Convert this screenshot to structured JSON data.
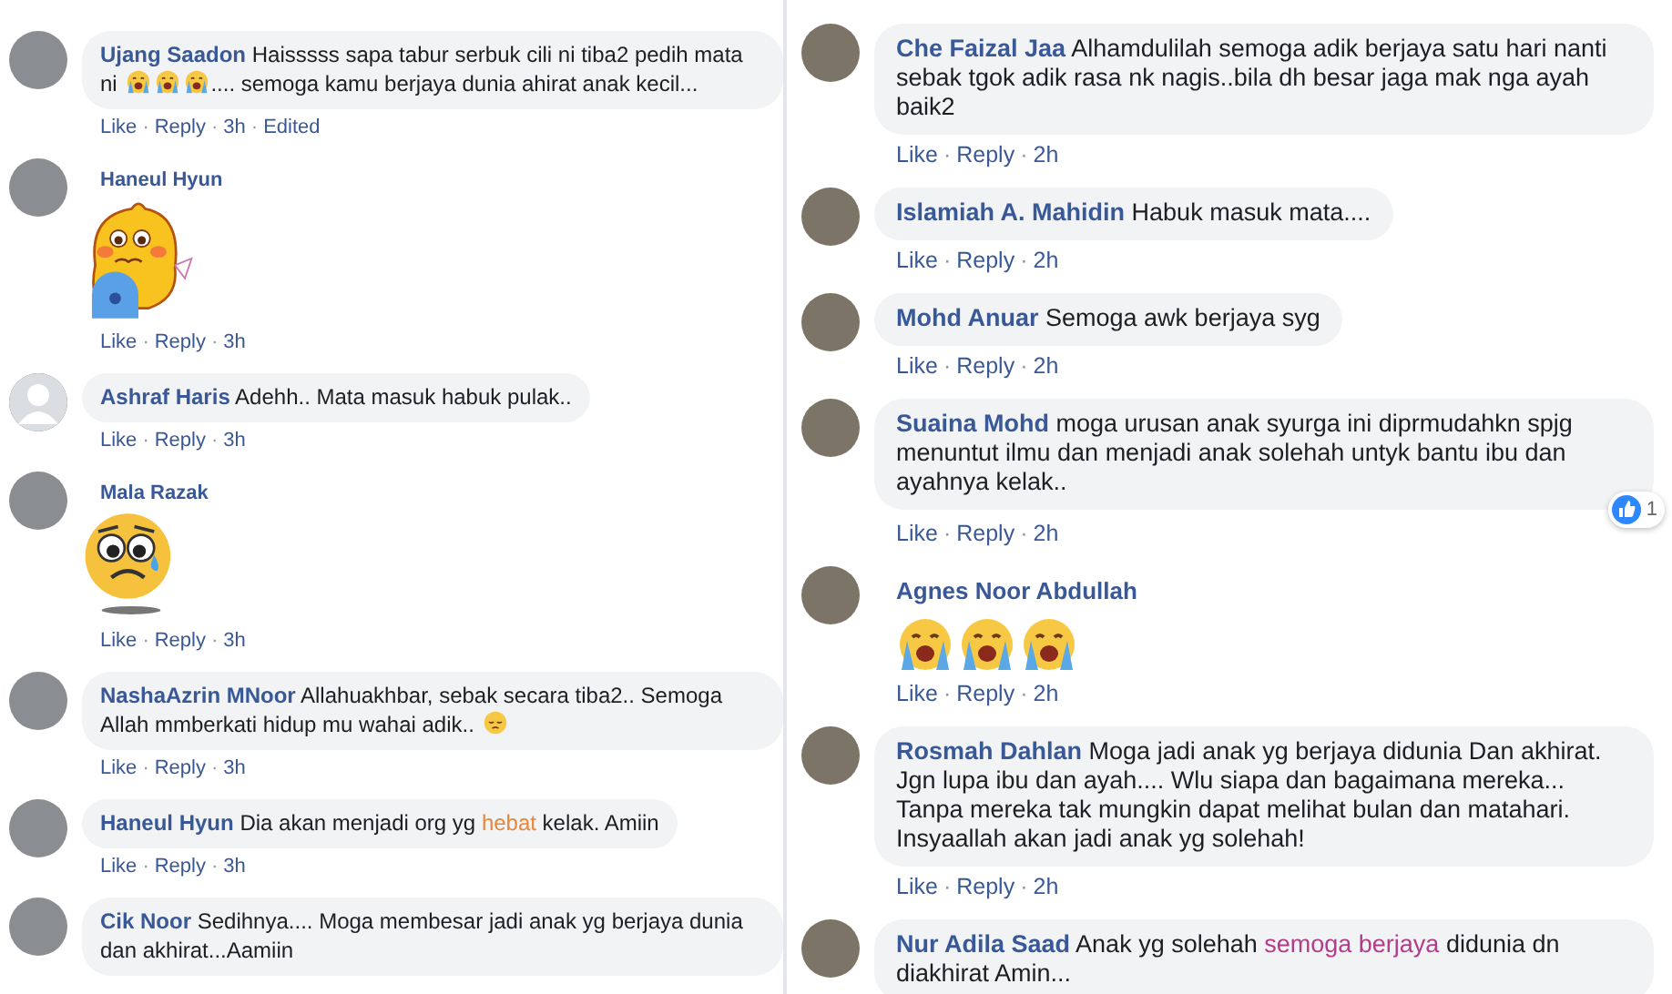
{
  "columns": [
    {
      "comments": [
        {
          "author": "Ujang Saadon",
          "avatar": {
            "kind": "photo"
          },
          "kind": "text",
          "segments": [
            {
              "kind": "text",
              "parts": [
                {
                  "text": "Haisssss sapa tabur serbuk cili ni tiba2 pedih mata ni "
                }
              ]
            },
            {
              "kind": "crying-emoji"
            },
            {
              "kind": "crying-emoji"
            },
            {
              "kind": "crying-emoji"
            },
            {
              "kind": "text",
              "parts": [
                {
                  "text": ".... semoga kamu berjaya dunia ahirat anak kecil..."
                }
              ]
            }
          ],
          "actions": [
            {
              "kind": "link",
              "text": "Like"
            },
            {
              "kind": "separator",
              "text": "·"
            },
            {
              "kind": "link",
              "text": "Reply"
            },
            {
              "kind": "separator",
              "text": "·"
            },
            {
              "kind": "time",
              "text": "3h"
            },
            {
              "kind": "separator",
              "text": "·"
            },
            {
              "kind": "label",
              "text": "Edited"
            }
          ]
        },
        {
          "author": "Haneul Hyun",
          "avatar": {
            "kind": "photo"
          },
          "kind": "sticker-cartoon",
          "actions": [
            {
              "kind": "link",
              "text": "Like"
            },
            {
              "kind": "separator",
              "text": "·"
            },
            {
              "kind": "link",
              "text": "Reply"
            },
            {
              "kind": "separator",
              "text": "·"
            },
            {
              "kind": "time",
              "text": "3h"
            }
          ]
        },
        {
          "author": "Ashraf Haris",
          "avatar": {
            "kind": "default"
          },
          "kind": "text",
          "segments": [
            {
              "kind": "text",
              "parts": [
                {
                  "text": "Adehh.. Mata masuk habuk pulak.."
                }
              ]
            }
          ],
          "actions": [
            {
              "kind": "link",
              "text": "Like"
            },
            {
              "kind": "separator",
              "text": "·"
            },
            {
              "kind": "link",
              "text": "Reply"
            },
            {
              "kind": "separator",
              "text": "·"
            },
            {
              "kind": "time",
              "text": "3h"
            }
          ]
        },
        {
          "author": "Mala Razak",
          "avatar": {
            "kind": "photo"
          },
          "kind": "sticker-sad-face",
          "actions": [
            {
              "kind": "link",
              "text": "Like"
            },
            {
              "kind": "separator",
              "text": "·"
            },
            {
              "kind": "link",
              "text": "Reply"
            },
            {
              "kind": "separator",
              "text": "·"
            },
            {
              "kind": "time",
              "text": "3h"
            }
          ]
        },
        {
          "author": "NashaAzrin MNoor",
          "avatar": {
            "kind": "photo"
          },
          "kind": "text",
          "segments": [
            {
              "kind": "text",
              "parts": [
                {
                  "text": "Allahuakhbar, sebak secara tiba2.. Semoga Allah mmberkati hidup mu wahai adik.. "
                }
              ]
            },
            {
              "kind": "pensive-emoji"
            }
          ],
          "actions": [
            {
              "kind": "link",
              "text": "Like"
            },
            {
              "kind": "separator",
              "text": "·"
            },
            {
              "kind": "link",
              "text": "Reply"
            },
            {
              "kind": "separator",
              "text": "·"
            },
            {
              "kind": "time",
              "text": "3h"
            }
          ]
        },
        {
          "author": "Haneul Hyun",
          "avatar": {
            "kind": "photo"
          },
          "kind": "text",
          "segments": [
            {
              "kind": "text",
              "parts": [
                {
                  "text": "Dia akan menjadi org yg "
                },
                {
                  "text": "hebat",
                  "color": "#e8863a"
                },
                {
                  "text": " kelak. Amiin"
                }
              ]
            }
          ],
          "actions": [
            {
              "kind": "link",
              "text": "Like"
            },
            {
              "kind": "separator",
              "text": "·"
            },
            {
              "kind": "link",
              "text": "Reply"
            },
            {
              "kind": "separator",
              "text": "·"
            },
            {
              "kind": "time",
              "text": "3h"
            }
          ]
        },
        {
          "author": "Cik Noor",
          "avatar": {
            "kind": "photo"
          },
          "kind": "text",
          "segments": [
            {
              "kind": "text",
              "parts": [
                {
                  "text": "Sedihnya.... Moga membesar jadi anak yg berjaya dunia dan akhirat...Aamiin"
                }
              ]
            }
          ]
        }
      ]
    },
    {
      "comments": [
        {
          "author": "Che Faizal Jaa",
          "avatar": {
            "kind": "photo"
          },
          "kind": "text",
          "segments": [
            {
              "kind": "text",
              "parts": [
                {
                  "text": "Alhamdulilah semoga adik berjaya satu hari nanti sebak tgok adik rasa nk nagis..bila dh besar jaga mak nga ayah baik2"
                }
              ]
            }
          ],
          "actions": [
            {
              "kind": "link",
              "text": "Like"
            },
            {
              "kind": "separator",
              "text": "·"
            },
            {
              "kind": "link",
              "text": "Reply"
            },
            {
              "kind": "separator",
              "text": "·"
            },
            {
              "kind": "time",
              "text": "2h"
            }
          ]
        },
        {
          "author": "Islamiah A. Mahidin",
          "avatar": {
            "kind": "photo"
          },
          "kind": "text",
          "segments": [
            {
              "kind": "text",
              "parts": [
                {
                  "text": "Habuk masuk mata...."
                }
              ]
            }
          ],
          "actions": [
            {
              "kind": "link",
              "text": "Like"
            },
            {
              "kind": "separator",
              "text": "·"
            },
            {
              "kind": "link",
              "text": "Reply"
            },
            {
              "kind": "separator",
              "text": "·"
            },
            {
              "kind": "time",
              "text": "2h"
            }
          ]
        },
        {
          "author": "Mohd Anuar",
          "avatar": {
            "kind": "photo"
          },
          "kind": "text",
          "segments": [
            {
              "kind": "text",
              "parts": [
                {
                  "text": "Semoga awk berjaya syg"
                }
              ]
            }
          ],
          "actions": [
            {
              "kind": "link",
              "text": "Like"
            },
            {
              "kind": "separator",
              "text": "·"
            },
            {
              "kind": "link",
              "text": "Reply"
            },
            {
              "kind": "separator",
              "text": "·"
            },
            {
              "kind": "time",
              "text": "2h"
            }
          ]
        },
        {
          "author": "Suaina Mohd",
          "avatar": {
            "kind": "photo"
          },
          "kind": "text",
          "segments": [
            {
              "kind": "text",
              "parts": [
                {
                  "text": "moga urusan anak syurga ini diprmudahkn spjg menuntut ilmu dan menjadi anak solehah untyk bantu ibu dan ayahnya kelak.."
                }
              ]
            }
          ],
          "reactions": "1",
          "actions": [
            {
              "kind": "link",
              "text": "Like"
            },
            {
              "kind": "separator",
              "text": "·"
            },
            {
              "kind": "link",
              "text": "Reply"
            },
            {
              "kind": "separator",
              "text": "·"
            },
            {
              "kind": "time",
              "text": "2h"
            }
          ]
        },
        {
          "author": "Agnes Noor Abdullah",
          "avatar": {
            "kind": "photo"
          },
          "kind": "emoji-only",
          "emojis": [
            {
              "kind": "crying-emoji"
            },
            {
              "kind": "crying-emoji"
            },
            {
              "kind": "crying-emoji"
            }
          ],
          "actions": [
            {
              "kind": "link",
              "text": "Like"
            },
            {
              "kind": "separator",
              "text": "·"
            },
            {
              "kind": "link",
              "text": "Reply"
            },
            {
              "kind": "separator",
              "text": "·"
            },
            {
              "kind": "time",
              "text": "2h"
            }
          ]
        },
        {
          "author": "Rosmah Dahlan",
          "avatar": {
            "kind": "photo"
          },
          "kind": "text",
          "segments": [
            {
              "kind": "text",
              "parts": [
                {
                  "text": "Moga jadi anak yg berjaya didunia Dan akhirat. Jgn lupa ibu dan ayah.... Wlu siapa dan bagaimana mereka... Tanpa mereka tak mungkin dapat melihat bulan dan matahari. Insyaallah akan jadi anak yg solehah!"
                }
              ]
            }
          ],
          "actions": [
            {
              "kind": "link",
              "text": "Like"
            },
            {
              "kind": "separator",
              "text": "·"
            },
            {
              "kind": "link",
              "text": "Reply"
            },
            {
              "kind": "separator",
              "text": "·"
            },
            {
              "kind": "time",
              "text": "2h"
            }
          ]
        },
        {
          "author": "Nur Adila Saad",
          "avatar": {
            "kind": "photo"
          },
          "kind": "text",
          "segments": [
            {
              "kind": "text",
              "parts": [
                {
                  "text": "Anak yg solehah "
                },
                {
                  "text": "semoga berjaya",
                  "color": "#b23c8a"
                },
                {
                  "text": " didunia dn diakhirat Amin..."
                }
              ]
            }
          ]
        }
      ]
    }
  ]
}
